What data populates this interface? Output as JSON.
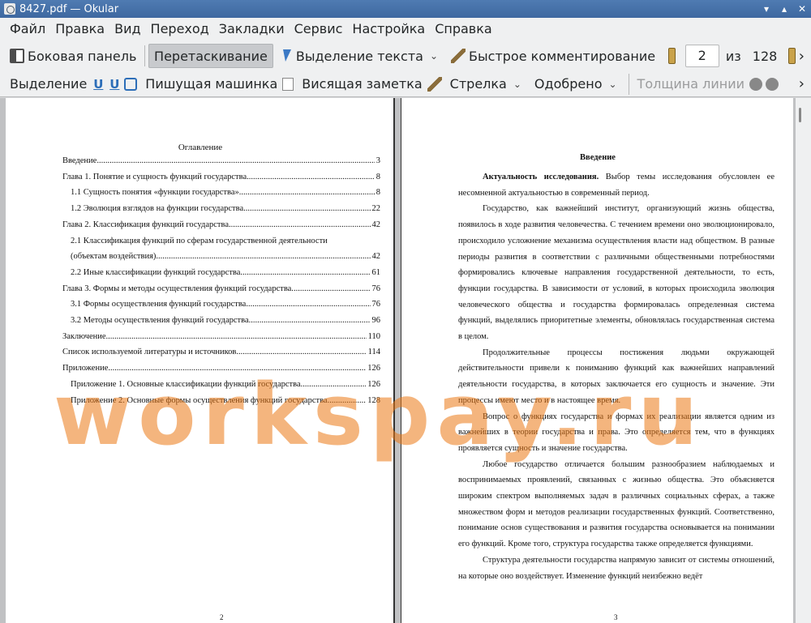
{
  "window": {
    "title": "8427.pdf — Okular"
  },
  "menu": [
    "Файл",
    "Правка",
    "Вид",
    "Переход",
    "Закладки",
    "Сервис",
    "Настройка",
    "Справка"
  ],
  "toolbar1": {
    "sidebar": "Боковая панель",
    "drag": "Перетаскивание",
    "select_text": "Выделение текста",
    "quick_comment": "Быстрое комментирование",
    "page_current": "2",
    "page_of": "из",
    "page_total": "128"
  },
  "toolbar2": {
    "highlight": "Выделение",
    "typewriter": "Пишущая машинка",
    "hanging_note": "Висящая заметка",
    "arrow": "Стрелка",
    "approved": "Одобрено",
    "line_width": "Толщина линии"
  },
  "left_page": {
    "toc_title": "Оглавление",
    "toc": [
      {
        "text": "Введение",
        "page": "3",
        "level": 1
      },
      {
        "text": "Глава 1. Понятие и сущность функций государства. ",
        "page": "8",
        "level": 1
      },
      {
        "text": "1.1 Сущность понятия «функции государства»",
        "page": "8",
        "level": 2
      },
      {
        "text": "1.2 Эволюция взглядов на функции государства ",
        "page": "22",
        "level": 2
      },
      {
        "text": "Глава 2. Классификация функций государства",
        "page": "42",
        "level": 1
      },
      {
        "text": "2.1 Классификация функций по сферам государственной деятельности",
        "page": "",
        "level": 2
      },
      {
        "text": "(объектам воздействия)",
        "page": "42",
        "level": 2
      },
      {
        "text": "2.2 Иные классификации функций государства",
        "page": "61",
        "level": 2
      },
      {
        "text": "Глава 3. Формы и методы осуществления функций государства. ",
        "page": "76",
        "level": 1
      },
      {
        "text": "3.1 Формы осуществления функций государства",
        "page": "76",
        "level": 2
      },
      {
        "text": "3.2 Методы осуществления функций государства",
        "page": "96",
        "level": 2
      },
      {
        "text": "Заключение ",
        "page": "110",
        "level": 1
      },
      {
        "text": "Список используемой литературы и источников ",
        "page": "114",
        "level": 1
      },
      {
        "text": "Приложение ",
        "page": "126",
        "level": 1
      },
      {
        "text": "Приложение 1. Основные классификации функций государства. ",
        "page": "126",
        "level": 3
      },
      {
        "text": "Приложение 2. Основные формы осуществления функций государства",
        "page": "128",
        "level": 3
      }
    ],
    "page_number": "2"
  },
  "right_page": {
    "heading": "Введение",
    "lead_bold": "Актуальность исследования.",
    "lead_rest": " Выбор темы исследования обусловлен ее несомненной актуальностью в современный период.",
    "paragraphs": [
      "Государство, как важнейший институт, организующий жизнь общества, появилось в ходе развития человечества. С течением времени оно эволюционировало, происходило усложнение механизма осуществления власти над обществом. В разные периоды развития в соответствии с различными общественными потребностями формировались ключевые направления государственной деятельности, то есть, функции государства. В зависимости от условий, в которых происходила эволюция человеческого общества и государства формировалась определенная система функций, выделялись приоритетные элементы, обновлялась государственная система в целом.",
      "Продолжительные процессы постижения людьми окружающей действительности привели к пониманию функций как важнейших направлений деятельности государства, в которых заключается его сущность и значение. Эти процессы имеют место и в настоящее время.",
      "Вопрос о функциях государства и формах их реализации является одним из важнейших в теории государства и права. Это определяется тем, что в функциях проявляется сущность и значение государства.",
      "Любое государство отличается большим разнообразием наблюдаемых и воспринимаемых проявлений, связанных с жизнью общества. Это объясняется широким спектром выполняемых задач в различных социальных сферах, а также множеством форм и методов реализации государственных функций. Соответственно, понимание основ существования и развития государства основывается на понимании его функций. Кроме того, структура государства также определяется функциями.",
      "Структура деятельности государства напрямую зависит от системы отношений, на которые оно воздействует. Изменение функций неизбежно ведёт"
    ],
    "page_number": "3"
  },
  "watermark": "workspay.ru",
  "colors": {
    "titlebar": "#4773ac",
    "watermark": "#eb7814"
  }
}
